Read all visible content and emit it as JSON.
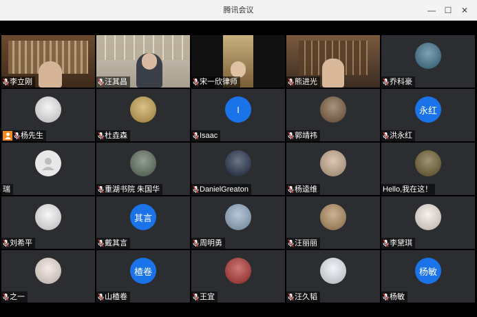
{
  "window": {
    "title": "腾讯会议"
  },
  "participants": [
    {
      "name": "李立刚",
      "type": "video",
      "active": true
    },
    {
      "name": "汪其昌",
      "type": "video"
    },
    {
      "name": "宋一欣律师",
      "type": "video"
    },
    {
      "name": "熊进光",
      "type": "video"
    },
    {
      "name": "乔科豪",
      "type": "avatar",
      "avatar_color": "#3a6f8c"
    },
    {
      "name": "杨先生",
      "type": "avatar",
      "avatar_color": "#f0f0f0",
      "host": true
    },
    {
      "name": "杜垚森",
      "type": "avatar",
      "avatar_color": "#c8a14a"
    },
    {
      "name": "Isaac",
      "type": "avatar",
      "avatar_color": "#1a73e8",
      "avatar_text": "I"
    },
    {
      "name": "郭靖祎",
      "type": "avatar",
      "avatar_color": "#7a5a3a"
    },
    {
      "name": "洪永红",
      "type": "avatar",
      "avatar_color": "#1a73e8",
      "avatar_text": "永红"
    },
    {
      "name": "瑞",
      "type": "avatar",
      "avatar_color": "#e8e8e8",
      "no_mic": true
    },
    {
      "name": "重湖书院 朱国华",
      "type": "avatar",
      "avatar_color": "#5a6b5a"
    },
    {
      "name": "DanielGreaton",
      "type": "avatar",
      "avatar_color": "#1d2b45"
    },
    {
      "name": "杨逵维",
      "type": "avatar",
      "avatar_color": "#c7a98b"
    },
    {
      "name": "Hello,我在这！",
      "type": "avatar",
      "avatar_color": "#6b5a2a",
      "no_mic": true
    },
    {
      "name": "刘希平",
      "type": "avatar",
      "avatar_color": "#f3f3f3"
    },
    {
      "name": "戴其言",
      "type": "avatar",
      "avatar_color": "#1a73e8",
      "avatar_text": "其言"
    },
    {
      "name": "周明勇",
      "type": "avatar",
      "avatar_color": "#8fa9c2"
    },
    {
      "name": "汪丽丽",
      "type": "avatar",
      "avatar_color": "#b08a5a"
    },
    {
      "name": "李黛琪",
      "type": "avatar",
      "avatar_color": "#f4e9e1"
    },
    {
      "name": "之一",
      "type": "avatar",
      "avatar_color": "#f1e2da"
    },
    {
      "name": "山楂卷",
      "type": "avatar",
      "avatar_color": "#1a73e8",
      "avatar_text": "楂卷"
    },
    {
      "name": "王宜",
      "type": "avatar",
      "avatar_color": "#b0302c"
    },
    {
      "name": "汪久韬",
      "type": "avatar",
      "avatar_color": "#e9eef5"
    },
    {
      "name": "杨敏",
      "type": "avatar",
      "avatar_color": "#1a73e8",
      "avatar_text": "杨敏"
    }
  ]
}
